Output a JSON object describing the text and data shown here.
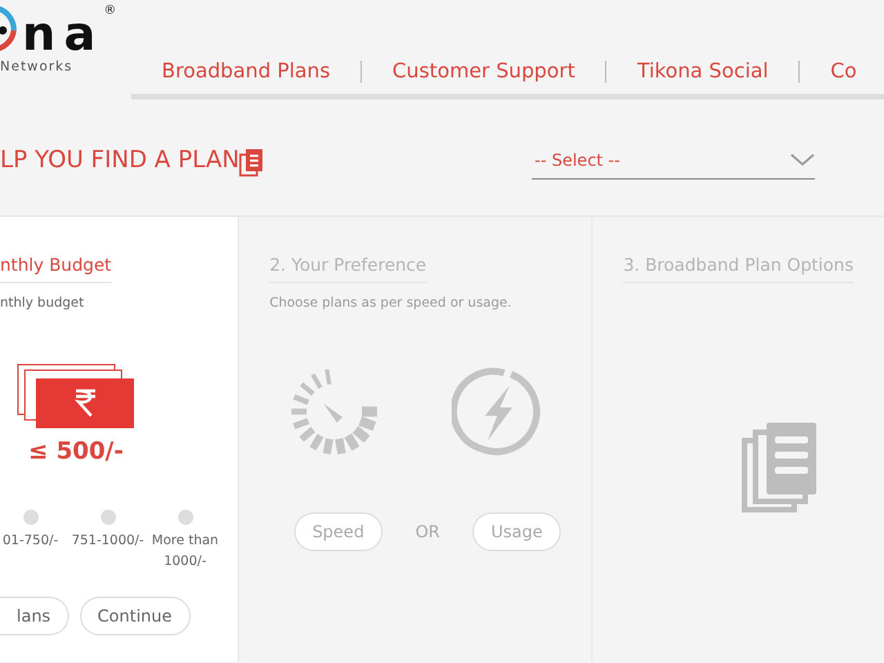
{
  "logo": {
    "wordmark": "na",
    "registered": "®",
    "tagline": "Networks"
  },
  "nav": [
    {
      "label": "Broadband Plans"
    },
    {
      "label": "Customer Support"
    },
    {
      "label": "Tikona Social"
    },
    {
      "label": "Co"
    }
  ],
  "finder": {
    "title": "LP YOU FIND A PLAN",
    "select": {
      "value": "-- Select --"
    }
  },
  "steps": [
    {
      "kind": "budget",
      "active": true,
      "title": "nthly Budget",
      "hint": "nthly budget",
      "amount": "≤ 500/-",
      "options": [
        {
          "label": "01-750/-",
          "selected": false
        },
        {
          "label": "751-1000/-",
          "selected": false
        },
        {
          "label": "More than 1000/-",
          "selected": false
        }
      ],
      "buttons": [
        "lans",
        "Continue"
      ]
    },
    {
      "kind": "preference",
      "active": false,
      "title": "2. Your Preference",
      "hint": "Choose plans as per speed or usage.",
      "choices": [
        "Speed",
        "Usage"
      ],
      "separator": "OR"
    },
    {
      "kind": "options",
      "active": false,
      "title": "3. Broadband Plan Options"
    }
  ]
}
